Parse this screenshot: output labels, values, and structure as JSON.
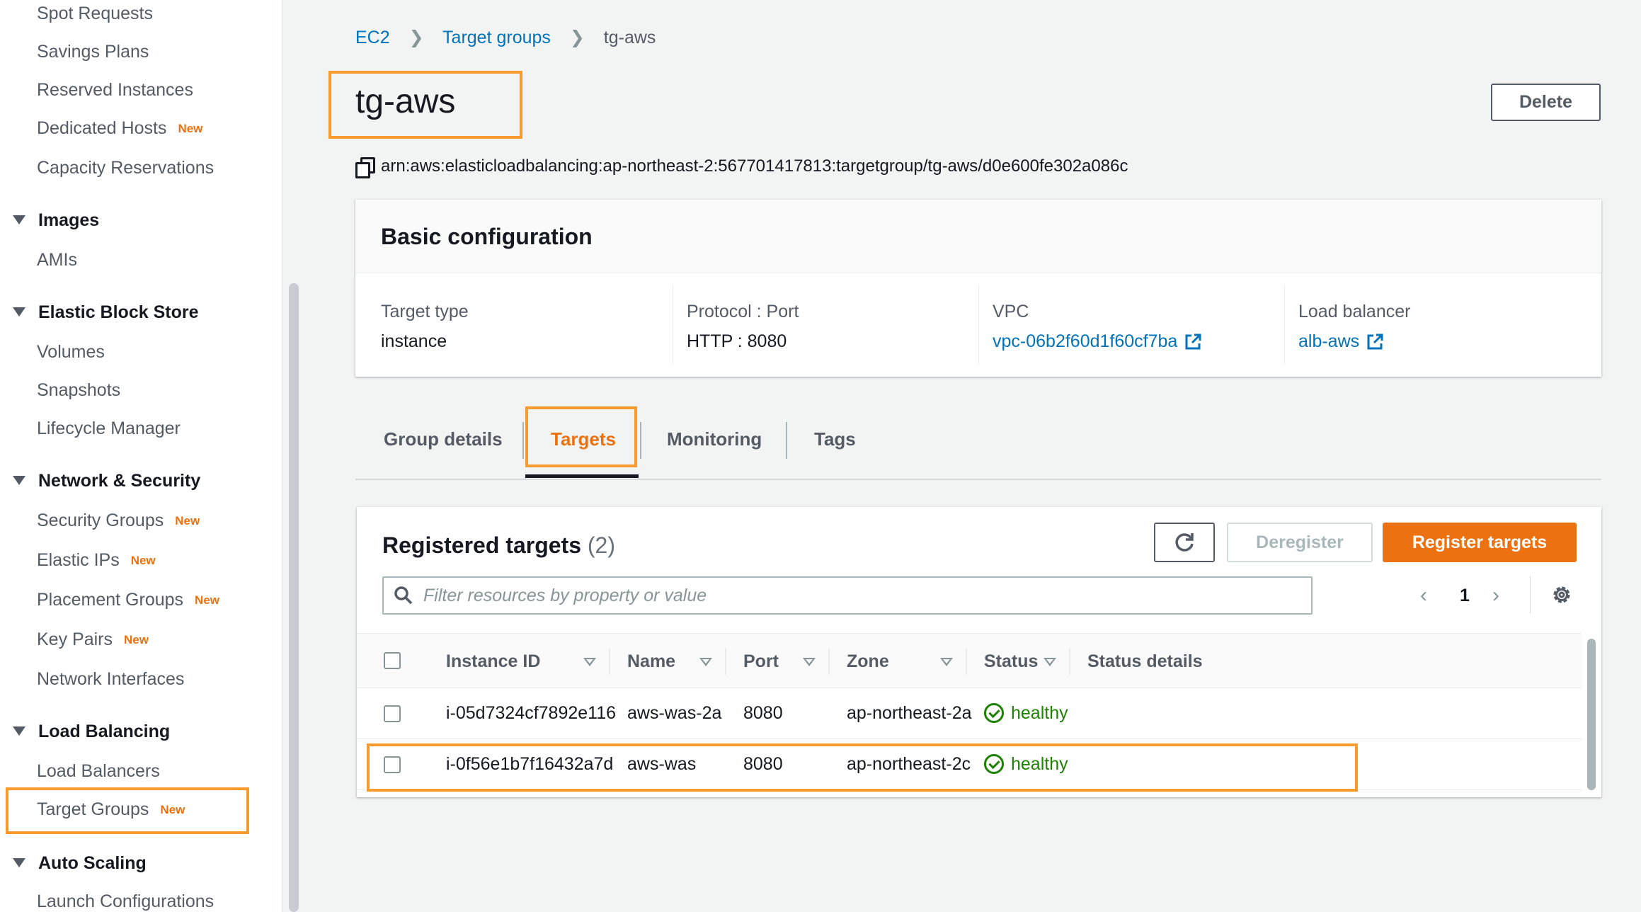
{
  "sidebar": {
    "items_top": [
      {
        "label": "Spot Requests",
        "badge": ""
      },
      {
        "label": "Savings Plans",
        "badge": ""
      },
      {
        "label": "Reserved Instances",
        "badge": ""
      },
      {
        "label": "Dedicated Hosts",
        "badge": "New"
      },
      {
        "label": "Capacity Reservations",
        "badge": ""
      }
    ],
    "images": {
      "title": "Images",
      "items": [
        "AMIs"
      ]
    },
    "ebs": {
      "title": "Elastic Block Store",
      "items": [
        "Volumes",
        "Snapshots",
        "Lifecycle Manager"
      ]
    },
    "network": {
      "title": "Network & Security",
      "items": [
        {
          "label": "Security Groups",
          "badge": "New"
        },
        {
          "label": "Elastic IPs",
          "badge": "New"
        },
        {
          "label": "Placement Groups",
          "badge": "New"
        },
        {
          "label": "Key Pairs",
          "badge": "New"
        },
        {
          "label": "Network Interfaces",
          "badge": ""
        }
      ]
    },
    "lb": {
      "title": "Load Balancing",
      "items": [
        {
          "label": "Load Balancers",
          "badge": ""
        },
        {
          "label": "Target Groups",
          "badge": "New"
        }
      ]
    },
    "autoscaling": {
      "title": "Auto Scaling",
      "items": [
        "Launch Configurations"
      ]
    }
  },
  "breadcrumb": {
    "items": [
      "EC2",
      "Target groups",
      "tg-aws"
    ],
    "separator": ">"
  },
  "page": {
    "title": "tg-aws",
    "delete_label": "Delete",
    "arn": "arn:aws:elasticloadbalancing:ap-northeast-2:567701417813:targetgroup/tg-aws/d0e600fe302a086c"
  },
  "basic_config": {
    "title": "Basic configuration",
    "fields": [
      {
        "label": "Target type",
        "value": "instance"
      },
      {
        "label": "Protocol : Port",
        "value": "HTTP : 8080"
      },
      {
        "label": "VPC",
        "value": "vpc-06b2f60d1f60cf7ba"
      },
      {
        "label": "Load balancer",
        "value": "alb-aws"
      }
    ]
  },
  "tabs": [
    "Group details",
    "Targets",
    "Monitoring",
    "Tags"
  ],
  "active_tab": "Targets",
  "registered": {
    "title": "Registered targets",
    "count": "(2)",
    "deregister_label": "Deregister",
    "register_label": "Register targets",
    "filter_placeholder": "Filter resources by property or value",
    "page": "1",
    "columns": [
      "Instance ID",
      "Name",
      "Port",
      "Zone",
      "Status",
      "Status details"
    ],
    "rows": [
      {
        "instance_id": "i-05d7324cf7892e116",
        "name": "aws-was-2a",
        "port": "8080",
        "zone": "ap-northeast-2a",
        "status": "healthy",
        "details": ""
      },
      {
        "instance_id": "i-0f56e1b7f16432a7d",
        "name": "aws-was",
        "port": "8080",
        "zone": "ap-northeast-2c",
        "status": "healthy",
        "details": ""
      }
    ]
  },
  "colors": {
    "accent": "#ec7211",
    "link": "#0073bb",
    "healthy": "#1d8102",
    "highlight": "#f79b2e"
  }
}
